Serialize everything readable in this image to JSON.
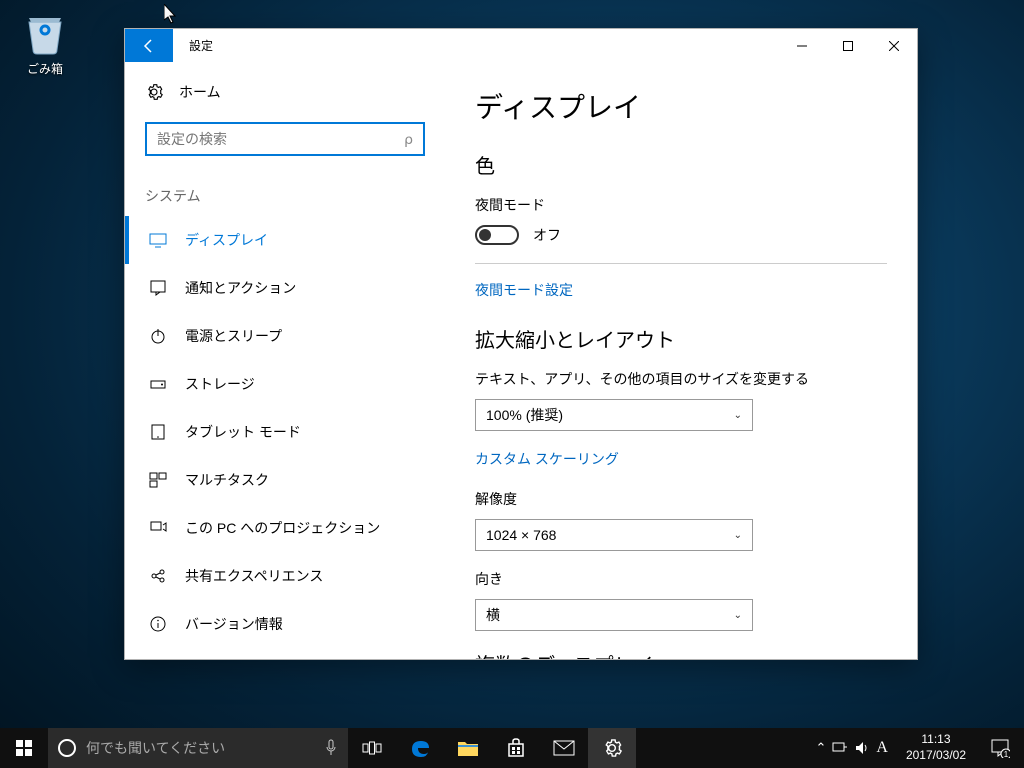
{
  "desktop": {
    "recycle_bin": "ごみ箱"
  },
  "window": {
    "title": "設定",
    "home": "ホーム",
    "search_placeholder": "設定の検索",
    "category": "システム"
  },
  "sidebar": {
    "items": [
      {
        "label": "ディスプレイ"
      },
      {
        "label": "通知とアクション"
      },
      {
        "label": "電源とスリープ"
      },
      {
        "label": "ストレージ"
      },
      {
        "label": "タブレット モード"
      },
      {
        "label": "マルチタスク"
      },
      {
        "label": "この PC へのプロジェクション"
      },
      {
        "label": "共有エクスペリエンス"
      },
      {
        "label": "バージョン情報"
      }
    ]
  },
  "content": {
    "heading": "ディスプレイ",
    "color_heading": "色",
    "night_mode_label": "夜間モード",
    "night_mode_value": "オフ",
    "night_mode_settings_link": "夜間モード設定",
    "scale_heading": "拡大縮小とレイアウト",
    "scale_label": "テキスト、アプリ、その他の項目のサイズを変更する",
    "scale_value": "100% (推奨)",
    "custom_scaling_link": "カスタム スケーリング",
    "resolution_label": "解像度",
    "resolution_value": "1024 × 768",
    "orientation_label": "向き",
    "orientation_value": "横",
    "multi_display_heading": "複数のディスプレイ"
  },
  "taskbar": {
    "search_placeholder": "何でも聞いてください",
    "ime": "A",
    "time": "11:13",
    "date": "2017/03/02",
    "notification_count": "1"
  }
}
